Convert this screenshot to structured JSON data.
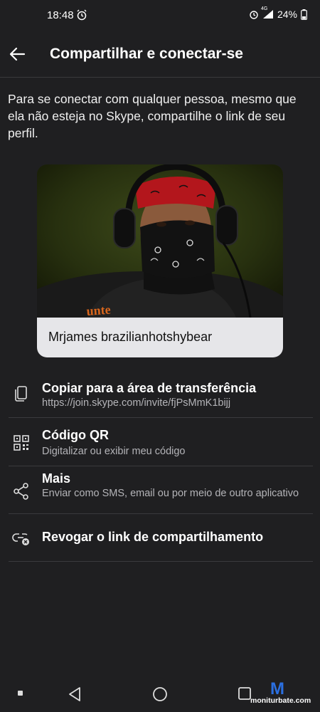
{
  "status_bar": {
    "time": "18:48",
    "network": "4G",
    "battery": "24%"
  },
  "header": {
    "title": "Compartilhar e conectar-se"
  },
  "intro_text": "Para se conectar com qualquer pessoa, mesmo que ela não esteja no Skype, compartilhe o link de seu perfil.",
  "profile_card": {
    "name": "Mrjames brazilianhotshybear",
    "shirt_text": "unte"
  },
  "actions": [
    {
      "title": "Copiar para a área de transferência",
      "subtitle": "https://join.skype.com/invite/fjPsMmK1bijj",
      "icon": "copy-icon"
    },
    {
      "title": "Código QR",
      "subtitle": "Digitalizar ou exibir meu código",
      "icon": "qr-code-icon"
    },
    {
      "title": "Mais",
      "subtitle": "Enviar como SMS, email ou por meio de outro aplicativo",
      "icon": "share-icon"
    },
    {
      "title": "Revogar o link de compartilhamento",
      "subtitle": "",
      "icon": "link-revoke-icon"
    }
  ],
  "watermark": {
    "text": "moniturbate.com",
    "letter": "M"
  },
  "colors": {
    "background": "#1f1f21",
    "divider": "#3a3a3d",
    "card_name_bg": "#e6e6e9",
    "subtitle": "#b4b4b8"
  }
}
